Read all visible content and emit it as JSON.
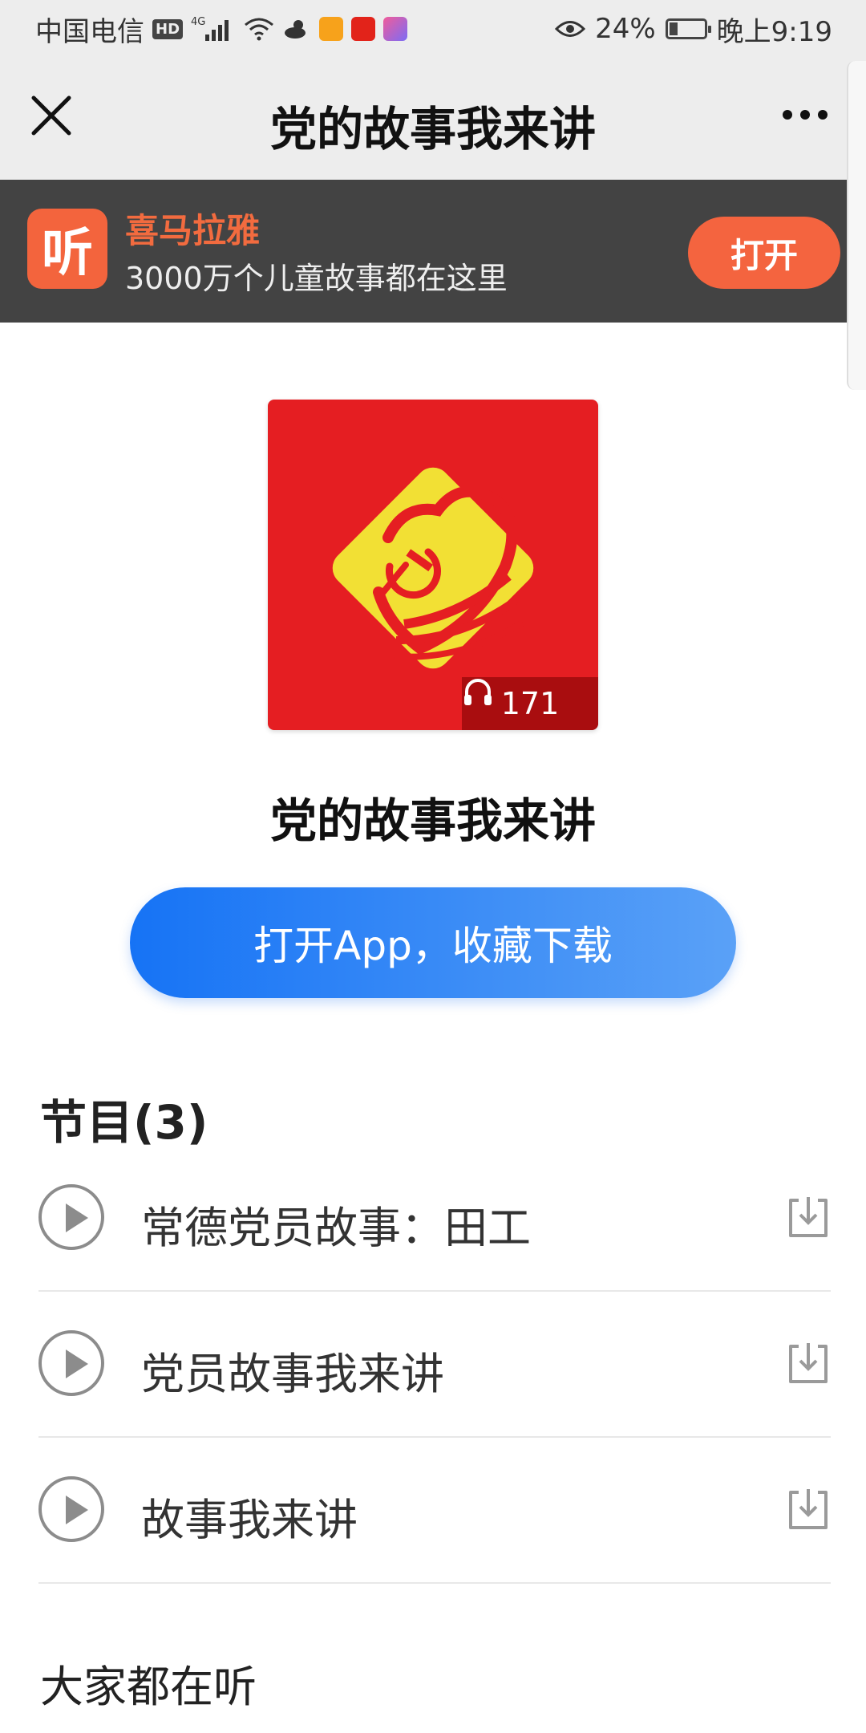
{
  "status_bar": {
    "carrier": "中国电信",
    "hd": "HD",
    "network": "4G",
    "battery": "24%",
    "time": "晚上9:19",
    "icons": [
      "hd-icon",
      "signal-icon",
      "wifi-icon",
      "weather-icon",
      "app-notification-icons",
      "eye-icon",
      "battery-icon"
    ]
  },
  "nav": {
    "title": "党的故事我来讲",
    "close_icon": "close-icon",
    "more_icon": "more-icon"
  },
  "app_banner": {
    "logo_text": "听",
    "app_name": "喜马拉雅",
    "slogan": "3000万个儿童故事都在这里",
    "open_label": "打开",
    "accent": "#f4643f"
  },
  "album": {
    "title": "党的故事我来讲",
    "play_count": "171",
    "cover_color": "#e51e22",
    "emblem_color": "#f2e034"
  },
  "open_app_button": {
    "label": "打开App，收藏下载",
    "color": "#1673f5"
  },
  "episodes": {
    "heading": "节目(3)",
    "items": [
      {
        "title": "常德党员故事：田工"
      },
      {
        "title": "党员故事我来讲"
      },
      {
        "title": "故事我来讲"
      }
    ]
  },
  "recommend": {
    "heading": "大家都在听"
  }
}
